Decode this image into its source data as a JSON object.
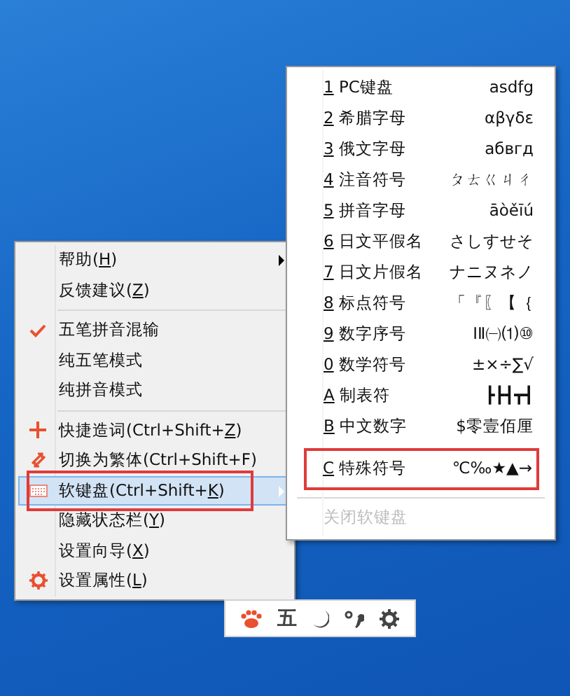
{
  "context_menu": {
    "groups": [
      [
        {
          "kind": "plain",
          "text": "帮助(",
          "key": "H",
          "after": ")",
          "submenu": true,
          "selected": false,
          "highlighted": false
        },
        {
          "kind": "plain",
          "text": "反馈建议(",
          "key": "Z",
          "after": ")",
          "submenu": false,
          "selected": false,
          "highlighted": false
        }
      ],
      [
        {
          "kind": "mode",
          "text": "五笔拼音混输",
          "checked": true,
          "submenu": false,
          "selected": false,
          "highlighted": false
        },
        {
          "kind": "mode",
          "text": "纯五笔模式",
          "checked": false,
          "submenu": false,
          "selected": false,
          "highlighted": false
        },
        {
          "kind": "mode",
          "text": "纯拼音模式",
          "checked": false,
          "submenu": false,
          "selected": false,
          "highlighted": false
        }
      ],
      [
        {
          "kind": "add",
          "text": "快捷造词(Ctrl+Shift+",
          "key": "Z",
          "after": ")",
          "submenu": false,
          "selected": false,
          "highlighted": false
        },
        {
          "kind": "convert",
          "text": "切换为繁体(Ctrl+Shift+F)",
          "submenu": false,
          "selected": false,
          "highlighted": false
        },
        {
          "kind": "keyboard",
          "text": "软键盘(Ctrl+Shift+",
          "key": "K",
          "after": ")",
          "submenu": true,
          "selected": true,
          "highlighted": true
        },
        {
          "kind": "plain",
          "text": "隐藏状态栏(",
          "key": "Y",
          "after": ")",
          "submenu": false,
          "selected": false,
          "highlighted": false
        },
        {
          "kind": "plain",
          "text": "设置向导(",
          "key": "X",
          "after": ")",
          "submenu": false,
          "selected": false,
          "highlighted": false
        },
        {
          "kind": "settings",
          "text": "设置属性(",
          "key": "L",
          "after": ")",
          "submenu": false,
          "selected": false,
          "highlighted": false
        }
      ]
    ]
  },
  "keyboard_submenu": {
    "rows": [
      {
        "key": "1",
        "name": "PC键盘",
        "sample": "asdfg",
        "highlighted": false
      },
      {
        "key": "2",
        "name": "希腊字母",
        "sample": "αβγδε",
        "highlighted": false
      },
      {
        "key": "3",
        "name": "俄文字母",
        "sample": "абвгд",
        "highlighted": false
      },
      {
        "key": "4",
        "name": "注音符号",
        "sample": "ㄆㄊㄍㄐㄔ",
        "highlighted": false
      },
      {
        "key": "5",
        "name": "拼音字母",
        "sample": "āòěīú",
        "highlighted": false
      },
      {
        "key": "6",
        "name": "日文平假名",
        "sample": "さしすせそ",
        "highlighted": false
      },
      {
        "key": "7",
        "name": "日文片假名",
        "sample": "ナニヌネノ",
        "highlighted": false
      },
      {
        "key": "8",
        "name": "标点符号",
        "sample": "「『〖【｛",
        "highlighted": false
      },
      {
        "key": "9",
        "name": "数字序号",
        "sample": "ⅠⅡ㈠⑴⑩",
        "highlighted": false
      },
      {
        "key": "0",
        "name": "数学符号",
        "sample": "±×÷∑√",
        "highlighted": false
      },
      {
        "key": "A",
        "name": "制表符",
        "sample": "┣┣┫┳┫",
        "highlighted": false
      },
      {
        "key": "B",
        "name": "中文数字",
        "sample": "$零壹佰厘",
        "highlighted": false
      },
      {
        "key": "C",
        "name": "特殊符号",
        "sample": "℃‰★▲→",
        "highlighted": true
      }
    ],
    "close_item": {
      "text": "关闭软键盘",
      "disabled": true
    }
  },
  "status_bar": {
    "buttons": [
      {
        "kind": "paw"
      },
      {
        "kind": "text",
        "text": "五"
      },
      {
        "kind": "moon"
      },
      {
        "kind": "punct"
      },
      {
        "kind": "gear"
      }
    ]
  }
}
